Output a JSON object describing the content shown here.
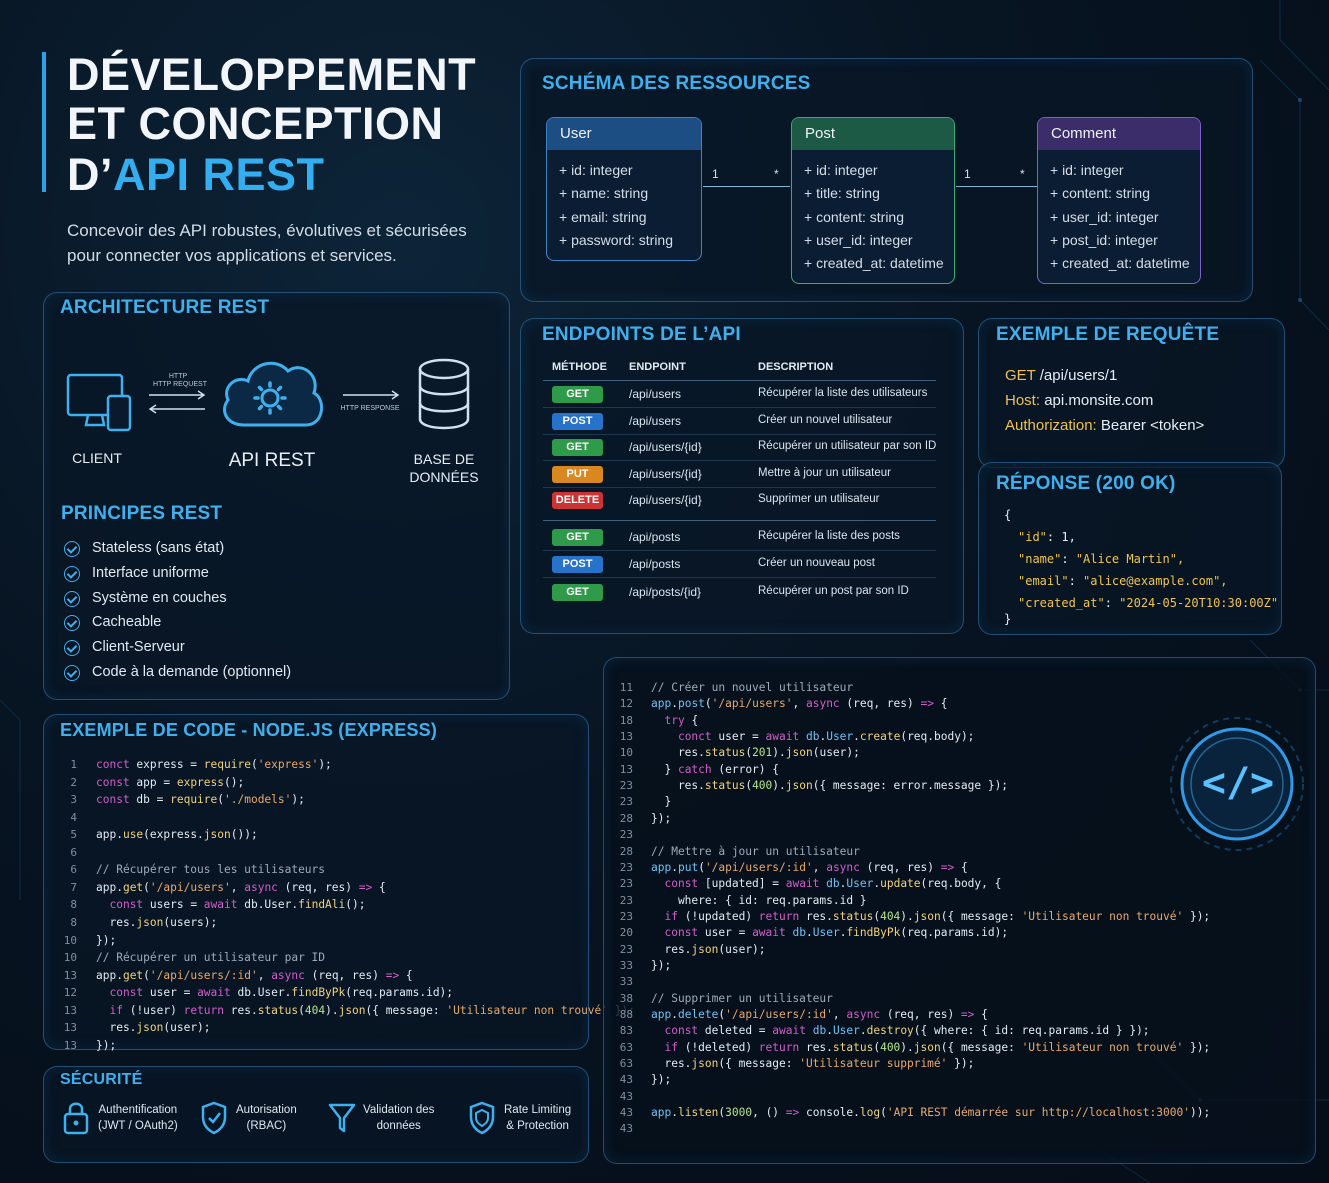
{
  "header": {
    "title_line1": "DÉVELOPPEMENT",
    "title_line2": "ET CONCEPTION",
    "title_line3_prefix": "D’",
    "title_line3_accent": "API REST",
    "subtitle": "Concevoir des API robustes, évolutives et sécurisées pour connecter vos applications et services."
  },
  "schema": {
    "title": "SCHÉMA DES RESSOURCES",
    "entities": [
      {
        "name": "User",
        "color": "#1c4e84",
        "fields": [
          "+ id: integer",
          "+ name: string",
          "+ email: string",
          "+ password: string"
        ]
      },
      {
        "name": "Post",
        "color": "#1d5a45",
        "fields": [
          "+ id: integer",
          "+ title: string",
          "+ content: string",
          "+ user_id: integer",
          "+ created_at: datetime"
        ]
      },
      {
        "name": "Comment",
        "color": "#3b2d6a",
        "fields": [
          "+ id: integer",
          "+ content: string",
          "+ user_id: integer",
          "+ post_id: integer",
          "+ created_at: datetime"
        ]
      }
    ],
    "relations": [
      {
        "from": "1",
        "to": "*"
      },
      {
        "from": "1",
        "to": "*"
      }
    ]
  },
  "architecture": {
    "title": "ARCHITECTURE REST",
    "client_label": "CLIENT",
    "api_label": "API REST",
    "db_label_1": "BASE DE",
    "db_label_2": "DONNÉES",
    "request_label_1": "HTTP",
    "request_label_2": "HTTP REQUEST",
    "response_label": "HTTP RESPONSE"
  },
  "principles": {
    "title": "PRINCIPES REST",
    "items": [
      "Stateless (sans état)",
      "Interface uniforme",
      "Système en couches",
      "Cacheable",
      "Client-Serveur",
      "Code à la demande (optionnel)"
    ]
  },
  "endpoints": {
    "title": "ENDPOINTS DE L’API",
    "headers": {
      "method": "MÉTHODE",
      "endpoint": "ENDPOINT",
      "description": "DESCRIPTION"
    },
    "method_colors": {
      "GET": "#2f9b4a",
      "POST": "#2673c9",
      "PUT": "#d9871f",
      "DELETE": "#cc3333"
    },
    "rows": [
      {
        "method": "GET",
        "path": "/api/users",
        "desc": "Récupérer la liste des utilisateurs"
      },
      {
        "method": "POST",
        "path": "/api/users",
        "desc": "Créer un nouvel utilisateur"
      },
      {
        "method": "GET",
        "path": "/api/users/{id}",
        "desc": "Récupérer un utilisateur par son ID"
      },
      {
        "method": "PUT",
        "path": "/api/users/{id}",
        "desc": "Mettre à jour un utilisateur"
      },
      {
        "method": "DELETE",
        "path": "/api/users/{id}",
        "desc": "Supprimer un utilisateur"
      },
      {
        "method": "GET",
        "path": "/api/posts",
        "desc": "Récupérer la liste des posts"
      },
      {
        "method": "POST",
        "path": "/api/posts",
        "desc": "Créer un nouveau post"
      },
      {
        "method": "GET",
        "path": "/api/posts/{id}",
        "desc": "Récupérer un post par son ID"
      }
    ]
  },
  "request": {
    "title": "EXEMPLE DE REQUÊTE",
    "method": "GET",
    "path": "/api/users/1",
    "host_key": "Host:",
    "host_val": "api.monsite.com",
    "auth_key": "Authorization:",
    "auth_val": "Bearer <token>"
  },
  "response": {
    "title": "RÉPONSE (200 OK)",
    "open": "{",
    "close": "}",
    "lines": [
      {
        "key": "\"id\"",
        "value": "1,"
      },
      {
        "key": "\"name\"",
        "value": "\"Alice Martin\","
      },
      {
        "key": "\"email\"",
        "value": "\"alice@example.com\","
      },
      {
        "key": "\"created_at\"",
        "value": "\"2024-05-20T10:30:00Z\""
      }
    ]
  },
  "code_left": {
    "title": "EXEMPLE DE CODE - NODE.JS (EXPRESS)",
    "line_numbers": [
      "1",
      "2",
      "3",
      "4",
      "5",
      "6",
      "6",
      "7",
      "8",
      "8",
      "10",
      "10",
      "13",
      "12",
      "13",
      "13",
      "13"
    ],
    "lines": [
      [
        {
          "t": "kw",
          "s": "conct"
        },
        {
          "s": " express = "
        },
        {
          "t": "fn",
          "s": "require"
        },
        {
          "s": "("
        },
        {
          "t": "str",
          "s": "'express'"
        },
        {
          "s": ");"
        }
      ],
      [
        {
          "t": "kw",
          "s": "const"
        },
        {
          "s": " app = "
        },
        {
          "t": "fn",
          "s": "express"
        },
        {
          "s": "();"
        }
      ],
      [
        {
          "t": "kw",
          "s": "const"
        },
        {
          "s": " db = "
        },
        {
          "t": "fn",
          "s": "require"
        },
        {
          "s": "("
        },
        {
          "t": "str",
          "s": "'./models'"
        },
        {
          "s": ");"
        }
      ],
      [],
      [
        {
          "s": "app."
        },
        {
          "t": "fn",
          "s": "use"
        },
        {
          "s": "(express."
        },
        {
          "t": "fn",
          "s": "json"
        },
        {
          "s": "());"
        }
      ],
      [],
      [
        {
          "t": "cm",
          "s": "// Récupérer tous les utilisateurs"
        }
      ],
      [
        {
          "s": "app."
        },
        {
          "t": "fn",
          "s": "get"
        },
        {
          "s": "("
        },
        {
          "t": "str",
          "s": "'/api/users'"
        },
        {
          "s": ", "
        },
        {
          "t": "kw",
          "s": "async"
        },
        {
          "s": " (req, res) "
        },
        {
          "t": "kw",
          "s": "=>"
        },
        {
          "s": " {"
        }
      ],
      [
        {
          "s": "  "
        },
        {
          "t": "kw",
          "s": "const"
        },
        {
          "s": " users = "
        },
        {
          "t": "kw",
          "s": "await"
        },
        {
          "s": " db.User."
        },
        {
          "t": "fn",
          "s": "findAli"
        },
        {
          "s": "();"
        }
      ],
      [
        {
          "s": "  res."
        },
        {
          "t": "fn",
          "s": "json"
        },
        {
          "s": "(users);"
        }
      ],
      [
        {
          "s": "});"
        }
      ],
      [
        {
          "t": "cm",
          "s": "// Récupérer un utilisateur par ID"
        }
      ],
      [
        {
          "s": "app."
        },
        {
          "t": "fn",
          "s": "get"
        },
        {
          "s": "("
        },
        {
          "t": "str",
          "s": "'/api/users/:id'"
        },
        {
          "s": ", "
        },
        {
          "t": "kw",
          "s": "async"
        },
        {
          "s": " (req, res) "
        },
        {
          "t": "kw",
          "s": "=>"
        },
        {
          "s": " {"
        }
      ],
      [
        {
          "s": "  "
        },
        {
          "t": "kw",
          "s": "const"
        },
        {
          "s": " user = "
        },
        {
          "t": "kw",
          "s": "await"
        },
        {
          "s": " db.User."
        },
        {
          "t": "fn",
          "s": "findByPk"
        },
        {
          "s": "(req.params.id);"
        }
      ],
      [
        {
          "s": "  "
        },
        {
          "t": "kw",
          "s": "if"
        },
        {
          "s": " (!user) "
        },
        {
          "t": "kw",
          "s": "return"
        },
        {
          "s": " res."
        },
        {
          "t": "fn",
          "s": "status"
        },
        {
          "s": "("
        },
        {
          "t": "num",
          "s": "404"
        },
        {
          "s": ")."
        },
        {
          "t": "fn",
          "s": "json"
        },
        {
          "s": "({ message: "
        },
        {
          "t": "str",
          "s": "'Utilisateur non trouvé'"
        },
        {
          "s": " });"
        }
      ],
      [
        {
          "s": "  res."
        },
        {
          "t": "fn",
          "s": "json"
        },
        {
          "s": "(user);"
        }
      ],
      [
        {
          "s": "});"
        }
      ]
    ]
  },
  "code_right": {
    "line_numbers": [
      "11",
      "12",
      "18",
      "13",
      "10",
      "13",
      "23",
      "23",
      "28",
      "23",
      "28",
      "23",
      "23",
      "23",
      "23",
      "20",
      "23",
      "33",
      "33",
      "38",
      "88",
      "83",
      "63",
      "63",
      "43",
      "43",
      "43",
      "43"
    ],
    "lines": [
      [
        {
          "t": "cm",
          "s": "// Créer un nouvel utilisateur"
        }
      ],
      [
        {
          "t": "var",
          "s": "app"
        },
        {
          "s": "."
        },
        {
          "t": "var",
          "s": "post"
        },
        {
          "s": "("
        },
        {
          "t": "str",
          "s": "'/api/users'"
        },
        {
          "s": ", "
        },
        {
          "t": "kw",
          "s": "async"
        },
        {
          "s": " (req, res) "
        },
        {
          "t": "kw",
          "s": "=>"
        },
        {
          "s": " {"
        }
      ],
      [
        {
          "s": "  "
        },
        {
          "t": "kw",
          "s": "try"
        },
        {
          "s": " {"
        }
      ],
      [
        {
          "s": "    "
        },
        {
          "t": "kw",
          "s": "conct"
        },
        {
          "s": " user = "
        },
        {
          "t": "kw",
          "s": "await"
        },
        {
          "s": " "
        },
        {
          "t": "var",
          "s": "db"
        },
        {
          "s": "."
        },
        {
          "t": "var",
          "s": "User"
        },
        {
          "s": "."
        },
        {
          "t": "fn",
          "s": "create"
        },
        {
          "s": "(req.body);"
        }
      ],
      [
        {
          "s": "    res."
        },
        {
          "t": "fn",
          "s": "status"
        },
        {
          "s": "("
        },
        {
          "t": "num",
          "s": "201"
        },
        {
          "s": ")."
        },
        {
          "t": "fn",
          "s": "json"
        },
        {
          "s": "(user);"
        }
      ],
      [
        {
          "s": "  } "
        },
        {
          "t": "kw",
          "s": "catch"
        },
        {
          "s": " (error) {"
        }
      ],
      [
        {
          "s": "    res."
        },
        {
          "t": "fn",
          "s": "status"
        },
        {
          "s": "("
        },
        {
          "t": "num",
          "s": "400"
        },
        {
          "s": ")."
        },
        {
          "t": "fn",
          "s": "json"
        },
        {
          "s": "({ message: error.message });"
        }
      ],
      [
        {
          "s": "  }"
        }
      ],
      [
        {
          "s": "});"
        }
      ],
      [],
      [
        {
          "t": "cm",
          "s": "// Mettre à jour un utilisateur"
        }
      ],
      [
        {
          "t": "var",
          "s": "app"
        },
        {
          "s": "."
        },
        {
          "t": "var",
          "s": "put"
        },
        {
          "s": "("
        },
        {
          "t": "str",
          "s": "'/api/users/:id'"
        },
        {
          "s": ", "
        },
        {
          "t": "kw",
          "s": "async"
        },
        {
          "s": " (req, res) "
        },
        {
          "t": "kw",
          "s": "=>"
        },
        {
          "s": " {"
        }
      ],
      [
        {
          "s": "  "
        },
        {
          "t": "kw",
          "s": "const"
        },
        {
          "s": " [updated] = "
        },
        {
          "t": "kw",
          "s": "await"
        },
        {
          "s": " "
        },
        {
          "t": "var",
          "s": "db"
        },
        {
          "s": "."
        },
        {
          "t": "var",
          "s": "User"
        },
        {
          "s": "."
        },
        {
          "t": "fn",
          "s": "update"
        },
        {
          "s": "(req.body, {"
        }
      ],
      [
        {
          "s": "    where: { id: req.params.id }"
        }
      ],
      [
        {
          "s": "  "
        },
        {
          "t": "kw",
          "s": "if"
        },
        {
          "s": " (!updated) "
        },
        {
          "t": "kw",
          "s": "return"
        },
        {
          "s": " res."
        },
        {
          "t": "fn",
          "s": "status"
        },
        {
          "s": "("
        },
        {
          "t": "num",
          "s": "404"
        },
        {
          "s": ")."
        },
        {
          "t": "fn",
          "s": "json"
        },
        {
          "s": "({ message: "
        },
        {
          "t": "str",
          "s": "'Utilisateur non trouvé'"
        },
        {
          "s": " });"
        }
      ],
      [
        {
          "s": "  "
        },
        {
          "t": "kw",
          "s": "const"
        },
        {
          "s": " user = "
        },
        {
          "t": "kw",
          "s": "await"
        },
        {
          "s": " "
        },
        {
          "t": "var",
          "s": "db"
        },
        {
          "s": "."
        },
        {
          "t": "var",
          "s": "User"
        },
        {
          "s": "."
        },
        {
          "t": "fn",
          "s": "findByPk"
        },
        {
          "s": "(req.params.id);"
        }
      ],
      [
        {
          "s": "  res."
        },
        {
          "t": "fn",
          "s": "json"
        },
        {
          "s": "(user);"
        }
      ],
      [
        {
          "s": "});"
        }
      ],
      [],
      [
        {
          "t": "cm",
          "s": "// Supprimer un utilisateur"
        }
      ],
      [
        {
          "t": "var",
          "s": "app"
        },
        {
          "s": "."
        },
        {
          "t": "var",
          "s": "delete"
        },
        {
          "s": "("
        },
        {
          "t": "str",
          "s": "'/api/users/:id'"
        },
        {
          "s": ", "
        },
        {
          "t": "kw",
          "s": "async"
        },
        {
          "s": " (req, res) "
        },
        {
          "t": "kw",
          "s": "=>"
        },
        {
          "s": " {"
        }
      ],
      [
        {
          "s": "  "
        },
        {
          "t": "kw",
          "s": "const"
        },
        {
          "s": " deleted = "
        },
        {
          "t": "kw",
          "s": "await"
        },
        {
          "s": " "
        },
        {
          "t": "var",
          "s": "db"
        },
        {
          "s": "."
        },
        {
          "t": "var",
          "s": "User"
        },
        {
          "s": "."
        },
        {
          "t": "fn",
          "s": "destroy"
        },
        {
          "s": "({ where: { id: req.params.id } });"
        }
      ],
      [
        {
          "s": "  "
        },
        {
          "t": "kw",
          "s": "if"
        },
        {
          "s": " (!deleted) "
        },
        {
          "t": "kw",
          "s": "return"
        },
        {
          "s": " res."
        },
        {
          "t": "fn",
          "s": "status"
        },
        {
          "s": "("
        },
        {
          "t": "num",
          "s": "400"
        },
        {
          "s": ")."
        },
        {
          "t": "fn",
          "s": "json"
        },
        {
          "s": "({ message: "
        },
        {
          "t": "str",
          "s": "'Utilisateur non trouvé'"
        },
        {
          "s": " });"
        }
      ],
      [
        {
          "s": "  res."
        },
        {
          "t": "fn",
          "s": "json"
        },
        {
          "s": "({ message: "
        },
        {
          "t": "str",
          "s": "'Utilisateur supprimé'"
        },
        {
          "s": " });"
        }
      ],
      [
        {
          "s": "});"
        }
      ],
      [],
      [
        {
          "t": "var",
          "s": "app"
        },
        {
          "s": "."
        },
        {
          "t": "fn",
          "s": "listen"
        },
        {
          "s": "("
        },
        {
          "t": "num",
          "s": "3000"
        },
        {
          "s": ", () "
        },
        {
          "t": "kw",
          "s": "=>"
        },
        {
          "s": " console."
        },
        {
          "t": "fn",
          "s": "log"
        },
        {
          "s": "("
        },
        {
          "t": "str",
          "s": "'API REST démarrée sur http://localhost:3000'"
        },
        {
          "s": "));"
        }
      ],
      []
    ]
  },
  "security": {
    "title": "SÉCURITÉ",
    "items": [
      {
        "icon": "lock-icon",
        "line1": "Authentification",
        "line2": "(JWT / OAuth2)"
      },
      {
        "icon": "shield-check-icon",
        "line1": "Autorisation",
        "line2": "(RBAC)"
      },
      {
        "icon": "filter-icon",
        "line1": "Validation des",
        "line2": "données"
      },
      {
        "icon": "shield-rate-icon",
        "line1": "Rate Limiting",
        "line2": "& Protection"
      }
    ]
  },
  "code_badge": {
    "symbol": "</>"
  }
}
